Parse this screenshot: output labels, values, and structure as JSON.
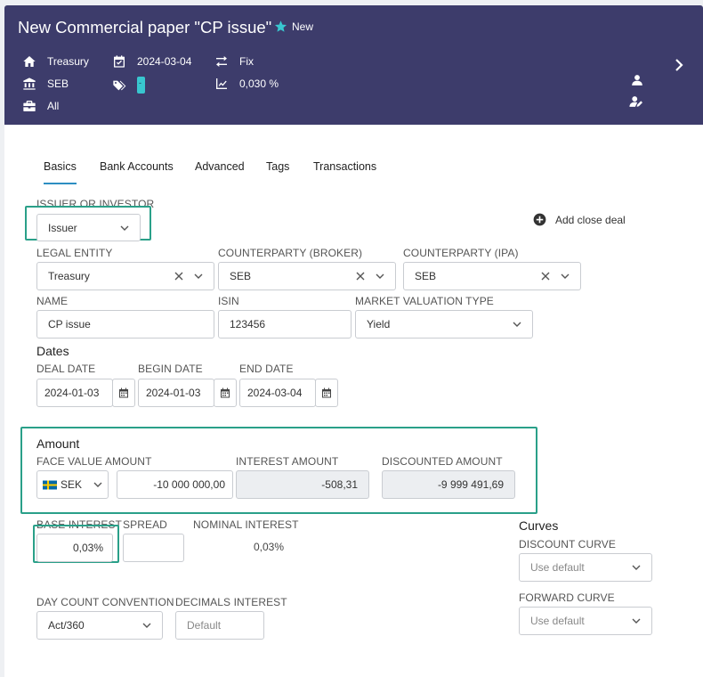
{
  "header": {
    "title": "New Commercial paper \"CP issue\"",
    "badge": "New",
    "portfolio": "Treasury",
    "bank": "SEB",
    "group": "All",
    "date": "2024-03-04",
    "tag": "-",
    "rate_type": "Fix",
    "rate": "0,030 %"
  },
  "tabs": [
    "Basics",
    "Bank Accounts",
    "Advanced",
    "Tags",
    "Transactions"
  ],
  "add_close_deal": "Add close deal",
  "issuer": {
    "label": "ISSUER OR INVESTOR",
    "value": "Issuer"
  },
  "legal_entity": {
    "label": "LEGAL ENTITY",
    "value": "Treasury"
  },
  "counterparty_broker": {
    "label": "COUNTERPARTY (BROKER)",
    "value": "SEB"
  },
  "counterparty_ipa": {
    "label": "COUNTERPARTY (IPA)",
    "value": "SEB"
  },
  "name": {
    "label": "NAME",
    "value": "CP issue"
  },
  "isin": {
    "label": "ISIN",
    "value": "123456"
  },
  "market_valuation": {
    "label": "MARKET VALUATION TYPE",
    "value": "Yield"
  },
  "dates": {
    "title": "Dates",
    "deal_label": "DEAL DATE",
    "deal_value": "2024-01-03",
    "begin_label": "BEGIN DATE",
    "begin_value": "2024-01-03",
    "end_label": "END DATE",
    "end_value": "2024-03-04"
  },
  "amount": {
    "title": "Amount",
    "face_label": "FACE VALUE AMOUNT",
    "currency": "SEK",
    "face_value": "-10 000 000,00",
    "interest_label": "INTEREST AMOUNT",
    "interest_value": "-508,31",
    "discounted_label": "DISCOUNTED AMOUNT",
    "discounted_value": "-9 999 491,69"
  },
  "interest": {
    "base_label": "BASE INTEREST",
    "base_value": "0,03%",
    "spread_label": "SPREAD",
    "spread_value": "",
    "nominal_label": "NOMINAL INTEREST",
    "nominal_value": "0,03%"
  },
  "day_count": {
    "label": "DAY COUNT CONVENTION",
    "value": "Act/360"
  },
  "decimals": {
    "label": "DECIMALS INTEREST",
    "placeholder": "Default"
  },
  "curves": {
    "title": "Curves",
    "discount_label": "DISCOUNT CURVE",
    "discount_value": "Use default",
    "forward_label": "FORWARD CURVE",
    "forward_value": "Use default"
  },
  "colors": {
    "header_bg": "#3d3c6b",
    "accent": "#2d8ec2",
    "highlight": "#2aa089",
    "tag_chip": "#38c6cf",
    "star": "#38c6cf"
  }
}
